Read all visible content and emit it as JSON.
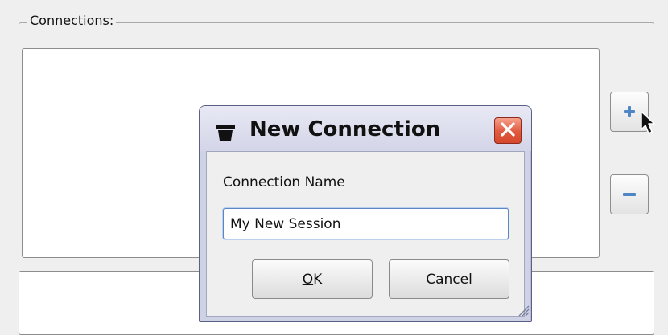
{
  "connections_group": {
    "label": "Connections:"
  },
  "side_buttons": {
    "add": "+",
    "remove": "−"
  },
  "dialog": {
    "title": "New Connection",
    "field_label": "Connection Name",
    "field_value": "My New Session",
    "ok_mnemonic": "O",
    "ok_rest": "K",
    "cancel_label": "Cancel"
  },
  "icons": {
    "add": "plus-icon",
    "remove": "minus-icon",
    "window": "window-app-icon",
    "close": "close-icon",
    "cursor": "mouse-pointer-icon",
    "grip": "resize-grip-icon"
  },
  "colors": {
    "dialog_frame": "#cfd1e5",
    "close_button": "#e05a3e",
    "input_focus": "#5b86c5",
    "icon_blue": "#4f86c6"
  }
}
